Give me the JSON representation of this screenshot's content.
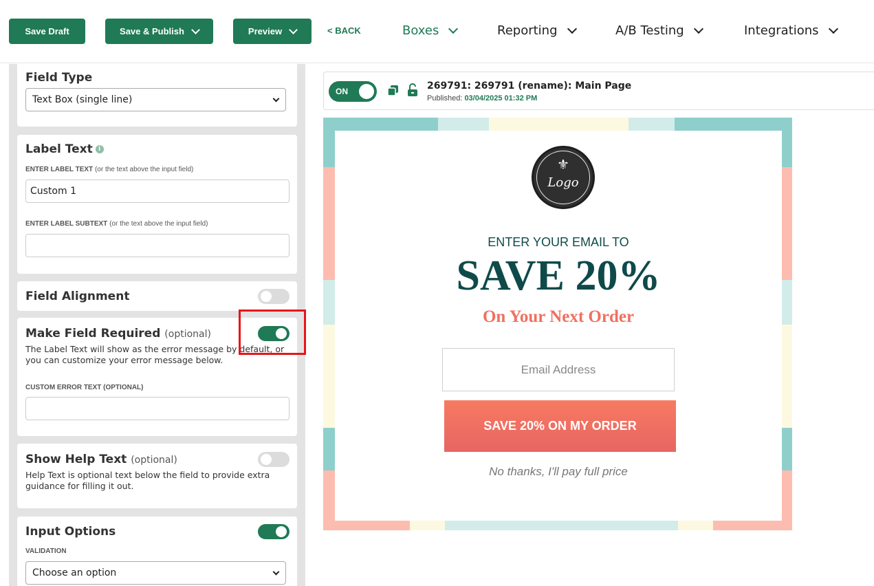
{
  "toolbar": {
    "save_draft": "Save Draft",
    "save_publish": "Save & Publish",
    "preview": "Preview",
    "back": "< BACK"
  },
  "nav": {
    "items": [
      {
        "label": "Boxes",
        "active": true
      },
      {
        "label": "Reporting",
        "active": false
      },
      {
        "label": "A/B Testing",
        "active": false
      },
      {
        "label": "Integrations",
        "active": false
      }
    ]
  },
  "sidebar": {
    "field_type": {
      "title": "Field Type",
      "selected": "Text Box (single line)"
    },
    "label_text": {
      "title": "Label Text",
      "info_glyph": "i",
      "enter_label_caption": "ENTER LABEL TEXT",
      "enter_label_hint": "(or the text above the input field)",
      "label_value": "Custom 1",
      "enter_subtext_caption": "ENTER LABEL SUBTEXT",
      "enter_subtext_hint": "(or the text above the input field)",
      "subtext_value": ""
    },
    "field_alignment": {
      "title": "Field Alignment",
      "enabled": false
    },
    "make_required": {
      "title": "Make Field Required",
      "optional": "(optional)",
      "enabled": true,
      "description": "The Label Text will show as the error message by default, or you can customize your error message below.",
      "custom_error_caption": "CUSTOM ERROR TEXT (OPTIONAL)",
      "custom_error_value": ""
    },
    "show_help": {
      "title": "Show Help Text",
      "optional": "(optional)",
      "enabled": false,
      "description": "Help Text is optional text below the field to provide extra guidance for filling it out."
    },
    "input_options": {
      "title": "Input Options",
      "enabled": true,
      "validation_caption": "VALIDATION",
      "validation_selected": "Choose an option"
    }
  },
  "status": {
    "toggle_label": "ON",
    "title": "269791: 269791 (rename): Main Page",
    "published_label": "Published:",
    "published_date": "03/04/2025 01:32 PM"
  },
  "popup": {
    "logo_text": "Logo",
    "fleur_glyph": "⚜",
    "enter_text": "ENTER YOUR EMAIL TO",
    "headline": "SAVE 20%",
    "subheadline": "On Your Next Order",
    "email_placeholder": "Email Address",
    "cta": "SAVE 20% ON MY ORDER",
    "decline": "No thanks, I'll pay full price",
    "border_colors": {
      "teal": "#8ecfcb",
      "light_teal": "#d2ecea",
      "cream": "#fdf9e0",
      "salmon": "#fdbcb0"
    }
  },
  "colors": {
    "brand_green": "#1f7a55",
    "headline_teal": "#0f4a4a",
    "accent_coral": "#f07060",
    "highlight_red": "#e8141b"
  }
}
